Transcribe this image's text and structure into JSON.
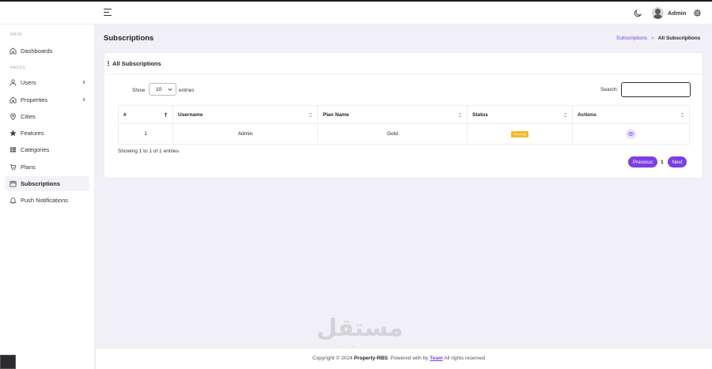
{
  "topbar": {
    "menu_icon": "hamburger-icon",
    "theme_icon": "moon-icon",
    "user_name": "Admin",
    "settings_icon": "gear-icon"
  },
  "sidebar": {
    "section_main": "MAIN",
    "section_pages": "PAGES",
    "dashboard": {
      "label": "Dashboards",
      "icon": "home-icon"
    },
    "items": [
      {
        "label": "Users",
        "icon": "user-icon",
        "has_children": true
      },
      {
        "label": "Properties",
        "icon": "home-icon",
        "has_children": true
      },
      {
        "label": "Cities",
        "icon": "location-pin-icon",
        "has_children": false
      },
      {
        "label": "Features",
        "icon": "star-icon",
        "has_children": false
      },
      {
        "label": "Categories",
        "icon": "grid-icon",
        "has_children": false
      },
      {
        "label": "Plans",
        "icon": "cart-icon",
        "has_children": false
      },
      {
        "label": "Subscriptions",
        "icon": "box-icon",
        "has_children": false,
        "active": true
      },
      {
        "label": "Push Notifications",
        "icon": "bell-icon",
        "has_children": false
      }
    ]
  },
  "page": {
    "title": "Subscriptions",
    "breadcrumb": [
      "Subscriptions",
      ">",
      "All Subscriptions"
    ]
  },
  "card": {
    "title": "All Subscriptions",
    "show_label": "Show",
    "page_length": "10",
    "entries_label": "entries",
    "search_label": "Search:",
    "search_value": ""
  },
  "table": {
    "columns": [
      "#",
      "Username",
      "Plan Name",
      "Status",
      "Actions"
    ],
    "rows": [
      {
        "num": "1",
        "username": "Admin",
        "plan": "Gold",
        "status": "Pending",
        "action_icon": "eye-icon"
      }
    ],
    "info": "Showing 1 to 1 of 1 entries"
  },
  "pagination": {
    "previous": "Previous",
    "current": "1",
    "next": "Next"
  },
  "footer": {
    "copyright": "Copyright © 2024",
    "brand": "Property-RBS",
    "powered": ". Powered with by",
    "team": "Team",
    "rights": "All rights reserved"
  },
  "watermark": {
    "arabic": "مستقل",
    "latin": "mostaql.com"
  },
  "colors": {
    "accent": "#7b3fe4",
    "pending": "#f5b824",
    "background": "#f0f0f6"
  }
}
